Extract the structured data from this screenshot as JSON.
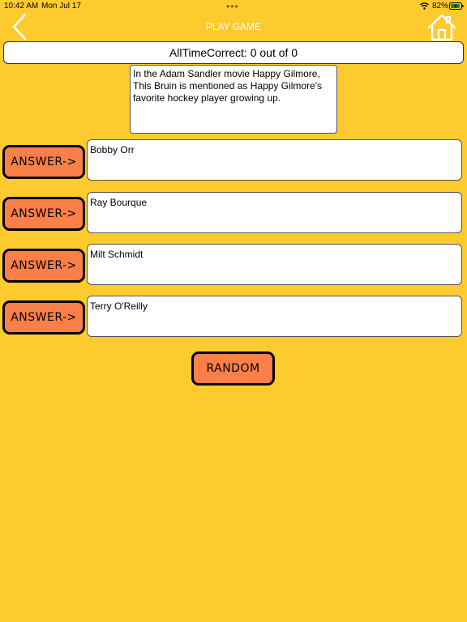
{
  "status_bar": {
    "time": "10:42 AM",
    "date": "Mon Jul 17",
    "battery": "82%"
  },
  "nav": {
    "title": "PLAY GAME"
  },
  "score": {
    "text": "AllTimeCorrect: 0 out of 0"
  },
  "question": {
    "text": "In the Adam Sandler movie Happy Gilmore, This Bruin is mentioned as Happy Gilmore's favorite hockey player growing up."
  },
  "answers": [
    {
      "button_label": "ANSWER->",
      "text": "Bobby Orr"
    },
    {
      "button_label": "ANSWER->",
      "text": "Ray Bourque"
    },
    {
      "button_label": "ANSWER->",
      "text": "Milt Schmidt"
    },
    {
      "button_label": "ANSWER->",
      "text": "Terry O'Reilly"
    }
  ],
  "random_button": {
    "label": "RANDOM"
  },
  "colors": {
    "background": "#fecb2f",
    "button": "#fb7f48",
    "nav_title": "#ffffff"
  },
  "icons": {
    "back": "chevron-left-icon",
    "home": "home-icon",
    "wifi": "wifi-icon",
    "battery": "battery-charging-icon"
  }
}
